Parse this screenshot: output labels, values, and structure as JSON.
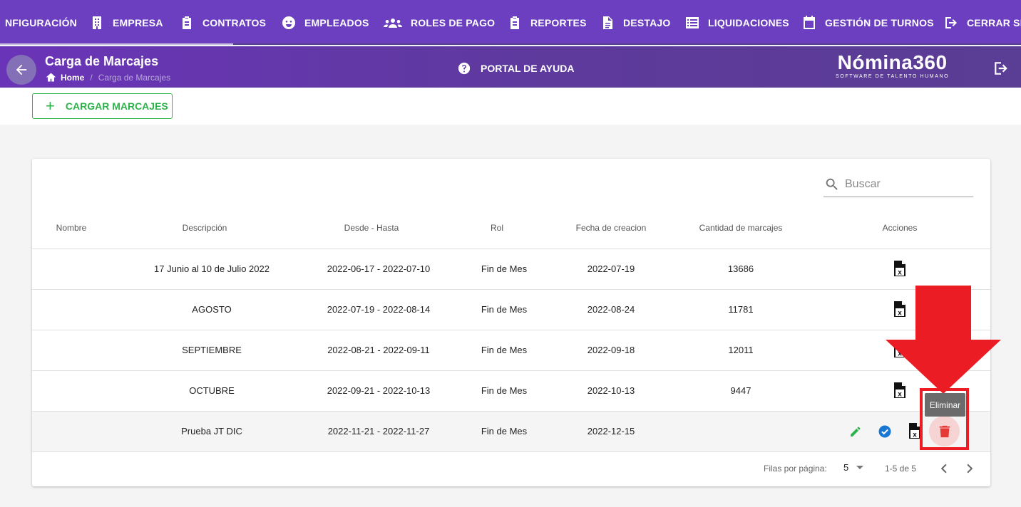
{
  "nav": {
    "items": [
      {
        "label": "NFIGURACIÓN",
        "icon": "settings-icon"
      },
      {
        "label": "EMPRESA",
        "icon": "building-icon"
      },
      {
        "label": "CONTRATOS",
        "icon": "clipboard-icon"
      },
      {
        "label": "EMPLEADOS",
        "icon": "face-icon"
      },
      {
        "label": "ROLES DE PAGO",
        "icon": "people-icon"
      },
      {
        "label": "REPORTES",
        "icon": "clipboard-icon"
      },
      {
        "label": "DESTAJO",
        "icon": "document-icon"
      },
      {
        "label": "LIQUIDACIONES",
        "icon": "list-icon"
      },
      {
        "label": "GESTIÓN DE TURNOS",
        "icon": "calendar-icon"
      },
      {
        "label": "CERRAR SE",
        "icon": "logout-icon"
      }
    ]
  },
  "header": {
    "title": "Carga de Marcajes",
    "breadcrumb": {
      "home": "Home",
      "separator": "/",
      "current": "Carga de Marcajes"
    },
    "help_label": "PORTAL DE AYUDA",
    "logo_main": "Nómina360",
    "logo_sub": "SOFTWARE DE TALENTO HUMANO"
  },
  "toolbar": {
    "load_label": "CARGAR MARCAJES"
  },
  "search": {
    "placeholder": "Buscar"
  },
  "table": {
    "columns": {
      "nombre": "Nombre",
      "descripcion": "Descripción",
      "rango": "Desde - Hasta",
      "rol": "Rol",
      "fecha": "Fecha de creacion",
      "cantidad": "Cantidad de marcajes",
      "acciones": "Acciones"
    },
    "rows": [
      {
        "nombre": "",
        "descripcion": "17 Junio al 10 de Julio 2022",
        "rango": "2022-06-17 - 2022-07-10",
        "rol": "Fin de Mes",
        "fecha": "2022-07-19",
        "cantidad": "13686"
      },
      {
        "nombre": "",
        "descripcion": "AGOSTO",
        "rango": "2022-07-19 - 2022-08-14",
        "rol": "Fin de Mes",
        "fecha": "2022-08-24",
        "cantidad": "11781"
      },
      {
        "nombre": "",
        "descripcion": "SEPTIEMBRE",
        "rango": "2022-08-21 - 2022-09-11",
        "rol": "Fin de Mes",
        "fecha": "2022-09-18",
        "cantidad": "12011"
      },
      {
        "nombre": "",
        "descripcion": "OCTUBRE",
        "rango": "2022-09-21 - 2022-10-13",
        "rol": "Fin de Mes",
        "fecha": "2022-10-13",
        "cantidad": "9447"
      },
      {
        "nombre": "",
        "descripcion": "Prueba JT DIC",
        "rango": "2022-11-21 - 2022-11-27",
        "rol": "Fin de Mes",
        "fecha": "2022-12-15",
        "cantidad": ""
      }
    ]
  },
  "pagination": {
    "rows_label": "Filas por página:",
    "rows_value": "5",
    "range": "1-5 de 5"
  },
  "tooltip": {
    "text": "Eliminar"
  },
  "colors": {
    "nav_bg": "#6c3fc0",
    "accent_green": "#2db34a",
    "annotation_red": "#ec1c24",
    "delete_red": "#e53935",
    "check_blue": "#1976d2"
  }
}
